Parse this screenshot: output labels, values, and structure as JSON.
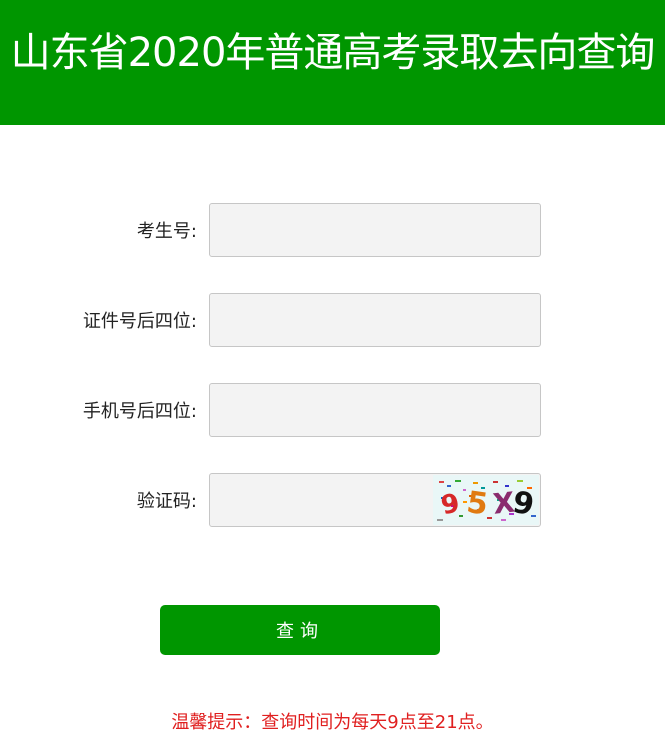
{
  "header": {
    "title": "山东省2020年普通高考录取去向查询"
  },
  "form": {
    "exam_number": {
      "label": "考生号:",
      "value": "",
      "placeholder": ""
    },
    "id_last4": {
      "label": "证件号后四位:",
      "value": "",
      "placeholder": ""
    },
    "phone_last4": {
      "label": "手机号后四位:",
      "value": "",
      "placeholder": ""
    },
    "captcha": {
      "label": "验证码:",
      "value": "",
      "placeholder": "",
      "image_text": "95X9"
    }
  },
  "submit_label": "查询",
  "tip": "温馨提示：查询时间为每天9点至21点。",
  "colors": {
    "brand_green": "#009600",
    "tip_red": "#e02020",
    "field_bg": "#f3f3f3"
  }
}
